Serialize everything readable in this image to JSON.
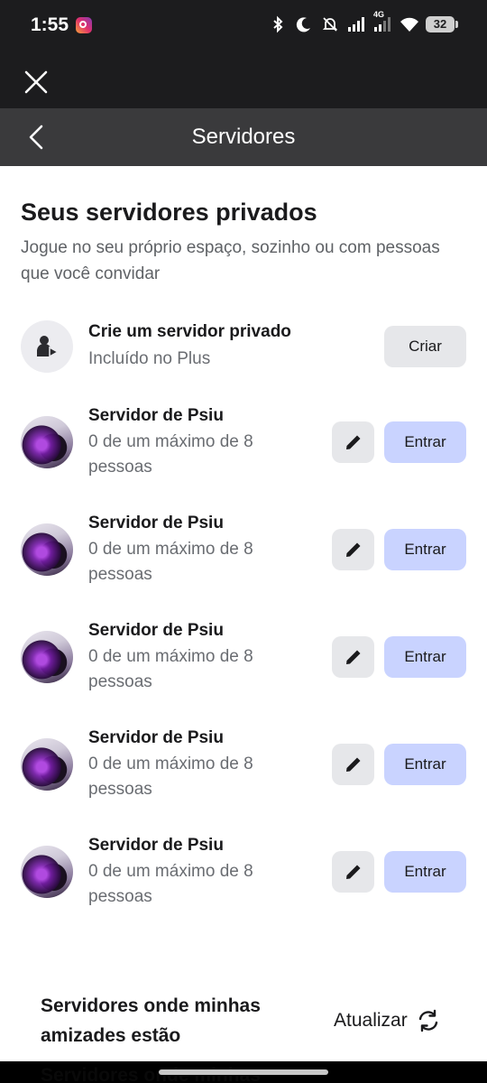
{
  "status_bar": {
    "time": "1:55",
    "battery": "32",
    "network_label": "4G"
  },
  "nav": {
    "title": "Servidores"
  },
  "private_servers": {
    "title": "Seus servidores privados",
    "subtitle": "Jogue no seu próprio espaço, sozinho ou com pessoas que você convidar",
    "create": {
      "title": "Crie um servidor privado",
      "subtitle": "Incluído no Plus",
      "button": "Criar"
    },
    "servers": [
      {
        "name": "Servidor de Psiu",
        "capacity": "0 de um máximo de 8 pessoas",
        "enter_label": "Entrar"
      },
      {
        "name": "Servidor de Psiu",
        "capacity": "0 de um máximo de 8 pessoas",
        "enter_label": "Entrar"
      },
      {
        "name": "Servidor de Psiu",
        "capacity": "0 de um máximo de 8 pessoas",
        "enter_label": "Entrar"
      },
      {
        "name": "Servidor de Psiu",
        "capacity": "0 de um máximo de 8 pessoas",
        "enter_label": "Entrar"
      },
      {
        "name": "Servidor de Psiu",
        "capacity": "0 de um máximo de 8 pessoas",
        "enter_label": "Entrar"
      }
    ]
  },
  "friends_servers": {
    "title": "Servidores onde minhas amizades estão",
    "refresh_label": "Atualizar",
    "peek_title": "Servidores onde minhas"
  },
  "icons": {
    "close": "close-icon",
    "back": "chevron-left-icon",
    "create": "person-play-icon",
    "edit": "pencil-icon",
    "refresh": "refresh-icon"
  },
  "colors": {
    "enter_button": "#c9d3ff",
    "secondary_button": "#e6e7ea",
    "nav_bar": "#3a3a3c",
    "status_bar": "#1c1c1e"
  }
}
